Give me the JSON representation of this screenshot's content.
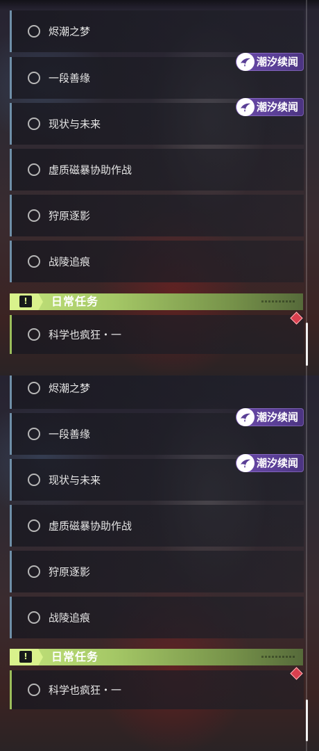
{
  "panels": [
    {
      "quests": [
        {
          "label": "烬潮之梦"
        },
        {
          "label": "一段善缘"
        },
        {
          "label": "现状与未来"
        },
        {
          "label": "虚质磁暴协助作战"
        },
        {
          "label": "狩原逐影"
        },
        {
          "label": "战陵追痕"
        }
      ],
      "badges": [
        {
          "label": "潮汐续闻"
        },
        {
          "label": "潮汐续闻"
        }
      ],
      "section": {
        "title": "日常任务",
        "icon": "exclamation-icon"
      },
      "daily_quests": [
        {
          "label": "科学也疯狂・一"
        }
      ]
    },
    {
      "quests": [
        {
          "label": "烬潮之梦"
        },
        {
          "label": "一段善缘"
        },
        {
          "label": "现状与未来"
        },
        {
          "label": "虚质磁暴协助作战"
        },
        {
          "label": "狩原逐影"
        },
        {
          "label": "战陵追痕"
        }
      ],
      "badges": [
        {
          "label": "潮汐续闻"
        },
        {
          "label": "潮汐续闻"
        }
      ],
      "section": {
        "title": "日常任务",
        "icon": "exclamation-icon"
      },
      "daily_quests": [
        {
          "label": "科学也疯狂・一"
        }
      ]
    }
  ],
  "colors": {
    "quest_accent": "#6f8fa8",
    "daily_accent": "#9bbd5b",
    "badge_purple": "#5a3f96",
    "marker_red": "#d9404f",
    "section_green": "#c4e47c"
  }
}
